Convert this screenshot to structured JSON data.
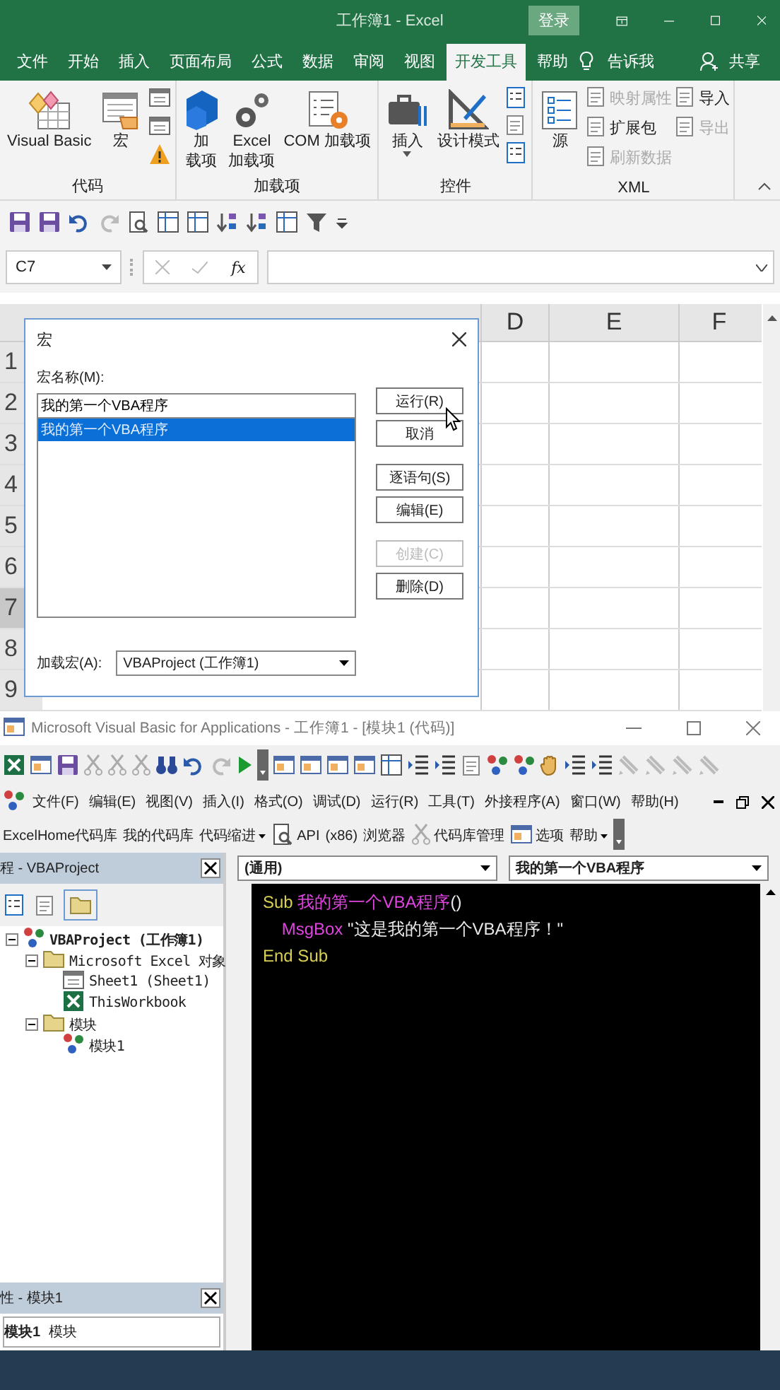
{
  "excel": {
    "title": "工作簿1  -  Excel",
    "login": "登录",
    "tabs": [
      {
        "label": "文件",
        "selected": false
      },
      {
        "label": "开始",
        "selected": false
      },
      {
        "label": "插入",
        "selected": false
      },
      {
        "label": "页面布局",
        "selected": false
      },
      {
        "label": "公式",
        "selected": false
      },
      {
        "label": "数据",
        "selected": false
      },
      {
        "label": "审阅",
        "selected": false
      },
      {
        "label": "视图",
        "selected": false
      },
      {
        "label": "开发工具",
        "selected": true
      },
      {
        "label": "帮助",
        "selected": false
      }
    ],
    "tell_me": "告诉我",
    "share": "共享",
    "ribbon_groups": [
      {
        "label": "代码",
        "items": [
          {
            "kind": "large",
            "lines": [
              "Visual Basic"
            ],
            "dropdown": false
          },
          {
            "kind": "large",
            "lines": [
              "宏"
            ],
            "dropdown": false
          },
          {
            "kind": "icon_stack"
          }
        ]
      },
      {
        "label": "加载项",
        "items": [
          {
            "kind": "large",
            "lines": [
              "加",
              "载项"
            ],
            "dropdown": false
          },
          {
            "kind": "large",
            "lines": [
              "Excel",
              "加载项"
            ],
            "dropdown": false
          },
          {
            "kind": "large",
            "lines": [
              "COM 加载项"
            ],
            "dropdown": false
          }
        ]
      },
      {
        "label": "控件",
        "items": [
          {
            "kind": "large",
            "lines": [
              "插入"
            ],
            "dropdown": true
          },
          {
            "kind": "large",
            "lines": [
              "设计模式"
            ],
            "dropdown": false
          },
          {
            "kind": "icon_stack"
          }
        ]
      },
      {
        "label": "XML",
        "items": [
          {
            "kind": "large",
            "lines": [
              "源"
            ],
            "dropdown": false
          },
          {
            "kind": "small_stack",
            "items": [
              {
                "label": "映射属性",
                "disabled": true
              },
              {
                "label": "扩展包",
                "disabled": false
              },
              {
                "label": "刷新数据",
                "disabled": true
              }
            ]
          },
          {
            "kind": "small_stack",
            "items": [
              {
                "label": "导入",
                "disabled": false
              },
              {
                "label": "导出",
                "disabled": true
              }
            ]
          }
        ]
      }
    ],
    "name_box": "C7",
    "fx": "fx",
    "sheet": {
      "columns": [
        "D",
        "E",
        "F"
      ],
      "rows": [
        {
          "label": "1",
          "selected": false
        },
        {
          "label": "2",
          "selected": false
        },
        {
          "label": "3",
          "selected": false
        },
        {
          "label": "4",
          "selected": false
        },
        {
          "label": "5",
          "selected": false
        },
        {
          "label": "6",
          "selected": false
        },
        {
          "label": "7",
          "selected": true
        },
        {
          "label": "8",
          "selected": false
        },
        {
          "label": "9",
          "selected": false
        }
      ]
    }
  },
  "dialog": {
    "title": "宏",
    "name_label": "宏名称(M):",
    "name_value": "我的第一个VBA程序",
    "list": [
      {
        "label": "我的第一个VBA程序",
        "selected": true
      }
    ],
    "button_groups": [
      [
        {
          "label": "运行(R)",
          "disabled": false
        },
        {
          "label": "取消",
          "disabled": false
        }
      ],
      [
        {
          "label": "逐语句(S)",
          "disabled": false
        },
        {
          "label": "编辑(E)",
          "disabled": false
        }
      ],
      [
        {
          "label": "创建(C)",
          "disabled": true
        },
        {
          "label": "删除(D)",
          "disabled": false
        }
      ]
    ],
    "macros_in_label": "加载宏(A):",
    "macros_in_value": "VBAProject (工作簿1)"
  },
  "vba": {
    "title": "Microsoft Visual Basic for Applications - 工作簿1 - [模块1 (代码)]",
    "menu": [
      "文件(F)",
      "编辑(E)",
      "视图(V)",
      "插入(I)",
      "格式(O)",
      "调试(D)",
      "运行(R)",
      "工具(T)",
      "外接程序(A)",
      "窗口(W)",
      "帮助(H)"
    ],
    "addins": [
      {
        "label": "ExcelHome代码库",
        "dropdown": false
      },
      {
        "label": "我的代码库",
        "dropdown": false
      },
      {
        "label": "代码缩进",
        "dropdown": true
      },
      {
        "label": "API",
        "dropdown": false
      },
      {
        "label": "(x86)",
        "dropdown": false
      },
      {
        "label": "浏览器",
        "dropdown": false
      },
      {
        "label": "代码库管理",
        "dropdown": false
      },
      {
        "label": "选项",
        "dropdown": false
      },
      {
        "label": "帮助",
        "dropdown": true
      }
    ],
    "project": {
      "title": "程 - VBAProject",
      "tree": [
        {
          "label": "VBAProject (工作簿1)",
          "kind": "project",
          "expanded": true,
          "children": [
            {
              "label": "Microsoft Excel 对象",
              "kind": "folder",
              "expanded": true,
              "children": [
                {
                  "label": "Sheet1 (Sheet1)",
                  "kind": "sheet"
                },
                {
                  "label": "ThisWorkbook",
                  "kind": "workbook"
                }
              ]
            },
            {
              "label": "模块",
              "kind": "folder",
              "expanded": true,
              "children": [
                {
                  "label": "模块1",
                  "kind": "module"
                }
              ]
            }
          ]
        }
      ]
    },
    "properties": {
      "title": "性 - 模块1",
      "object_name": "模块1",
      "object_type": "模块"
    },
    "code": {
      "object": "(通用)",
      "procedure": "我的第一个VBA程序",
      "lines": [
        [
          {
            "kind": "keyword",
            "text": "Sub "
          },
          {
            "kind": "name",
            "text": "我的第一个VBA程序"
          },
          {
            "kind": "plain",
            "text": "()"
          }
        ],
        [
          {
            "kind": "name",
            "text": "    MsgBox "
          },
          {
            "kind": "plain",
            "text": "\"这是我的第一个VBA程序！\""
          }
        ],
        [
          {
            "kind": "keyword",
            "text": "End Sub"
          }
        ]
      ]
    }
  }
}
